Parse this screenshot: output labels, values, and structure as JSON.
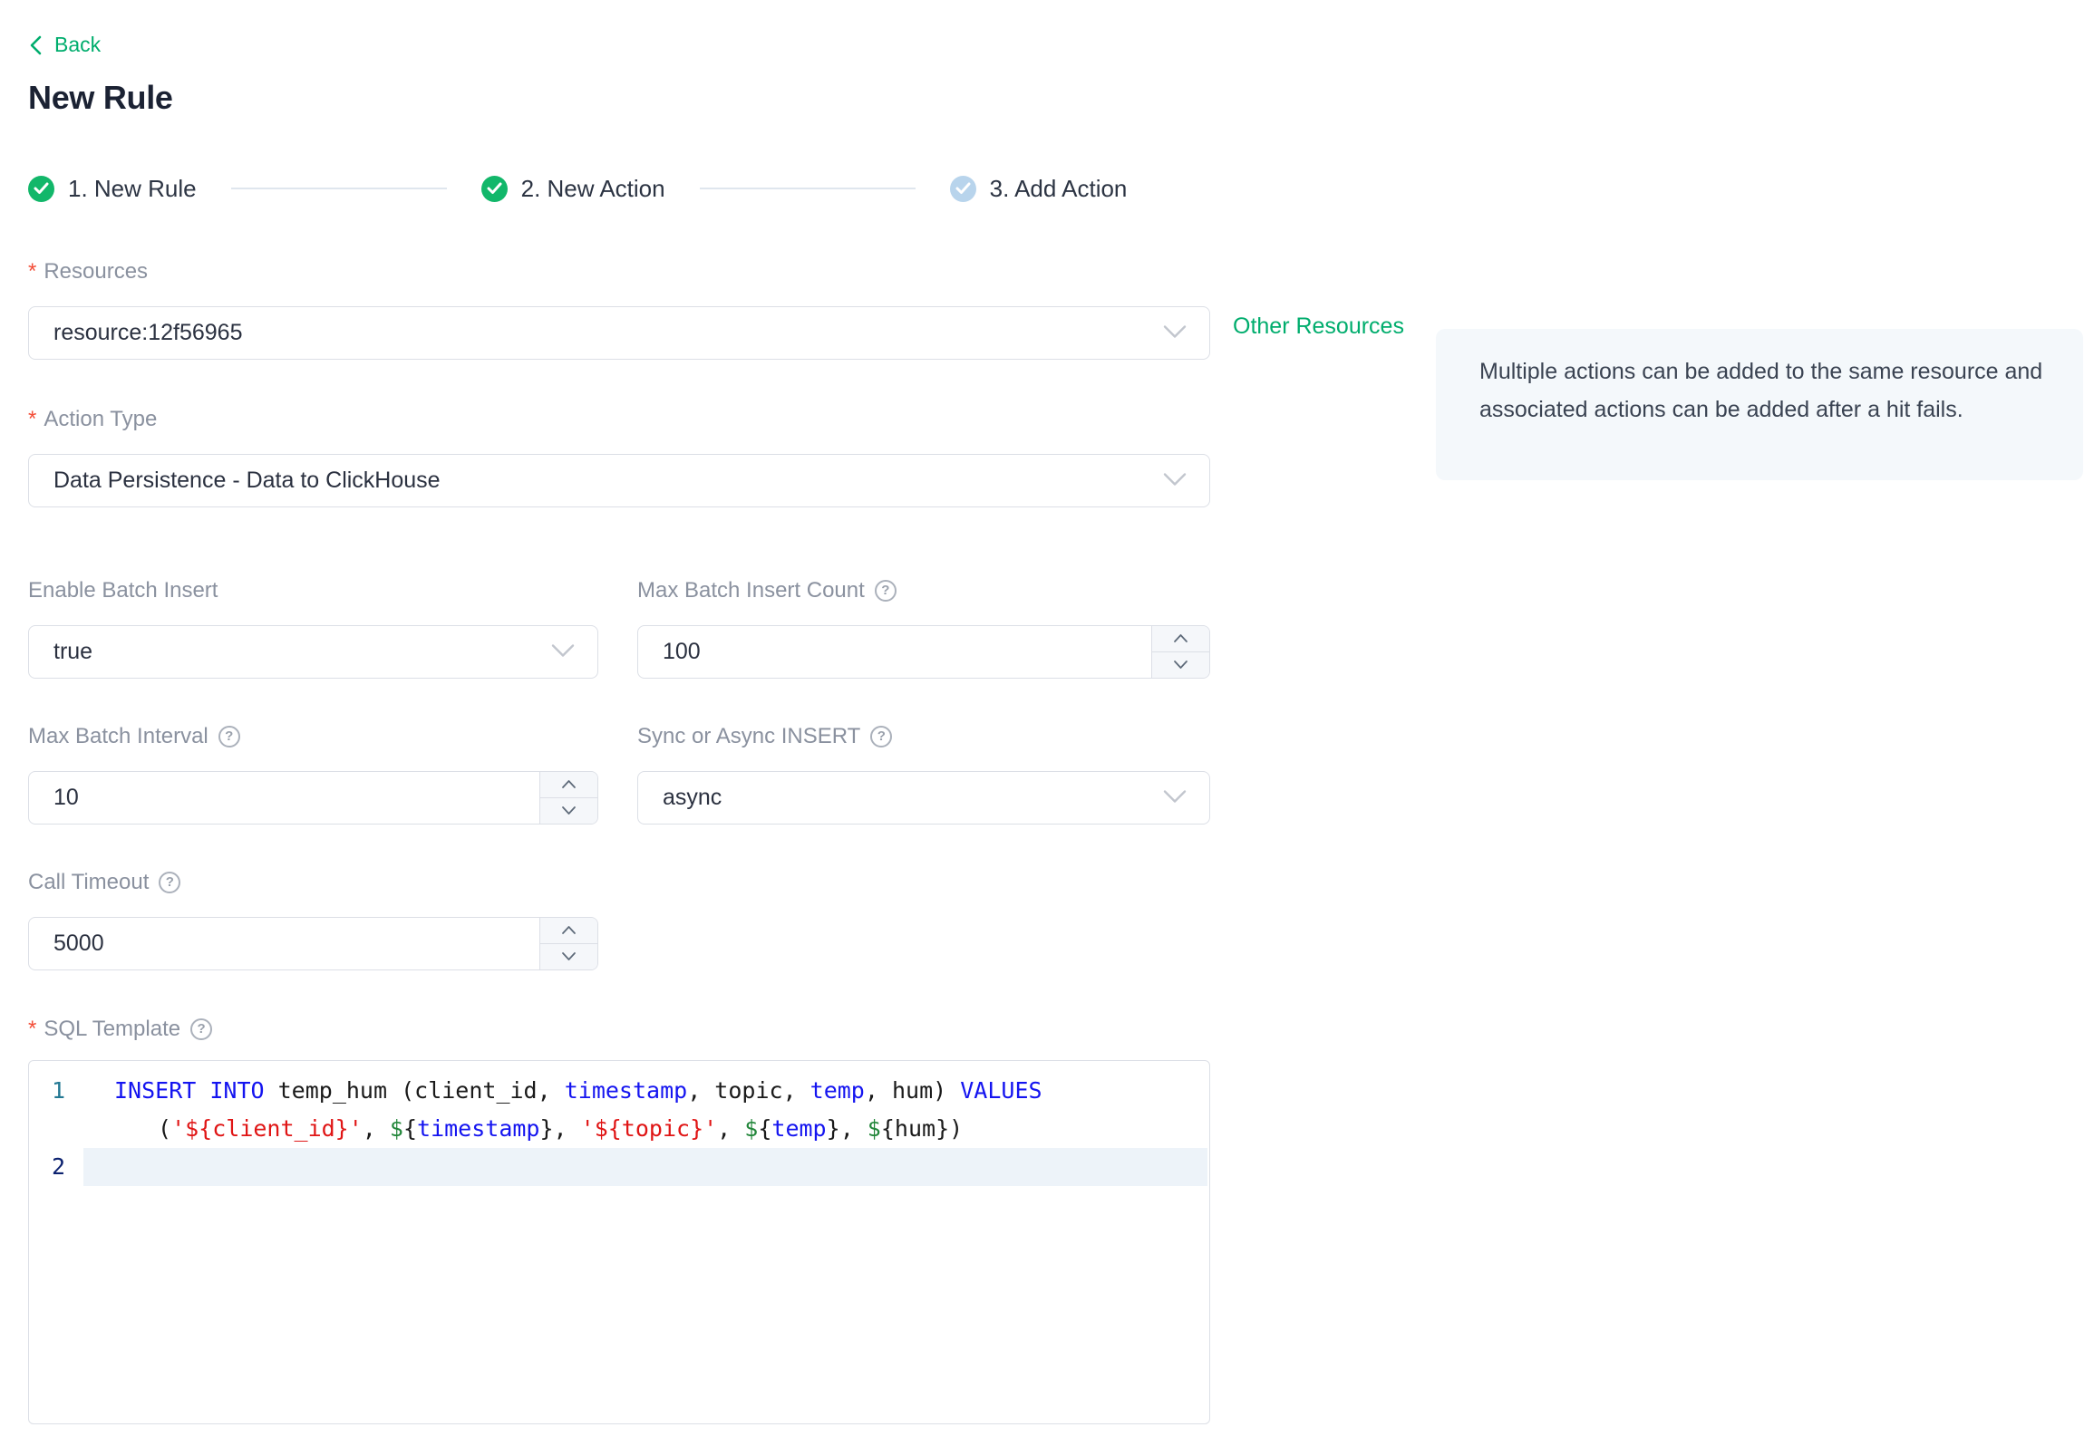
{
  "colors": {
    "accent_green": "#00ad6d",
    "step_done_green": "#12b76a",
    "step_pending_blue": "#b8d4ec",
    "required_red": "#f34d37",
    "info_box_bg": "#f4f8fb",
    "code_keyword_blue": "#1414f0",
    "code_string_red": "#e01515",
    "code_variable_green": "#22863a",
    "line_number_teal": "#237893",
    "active_line_number_navy": "#0b216f"
  },
  "header": {
    "back_label": "Back",
    "title": "New Rule"
  },
  "steps": [
    {
      "label": "1. New Rule",
      "state": "done"
    },
    {
      "label": "2. New Action",
      "state": "done"
    },
    {
      "label": "3. Add Action",
      "state": "pending"
    }
  ],
  "required_marker": "*",
  "help_glyph": "?",
  "form": {
    "resources": {
      "label": "Resources",
      "value": "resource:12f56965"
    },
    "other_resources": "Other Resources",
    "info_note": "Multiple actions can be added to the same resource and associated actions can be added after a hit fails.",
    "action_type": {
      "label": "Action Type",
      "value": "Data Persistence - Data to ClickHouse"
    },
    "enable_batch_insert": {
      "label": "Enable Batch Insert",
      "value": "true"
    },
    "max_batch_insert_count": {
      "label": "Max Batch Insert Count",
      "value": "100"
    },
    "max_batch_interval": {
      "label": "Max Batch Interval",
      "value": "10"
    },
    "sync_or_async_insert": {
      "label": "Sync or Async INSERT",
      "value": "async"
    },
    "call_timeout": {
      "label": "Call Timeout",
      "value": "5000"
    },
    "sql_template": {
      "label": "SQL Template"
    }
  },
  "sql_editor": {
    "sql_text": "INSERT INTO temp_hum (client_id, timestamp, topic, temp, hum) VALUES ('${client_id}', ${timestamp}, '${topic}', ${temp}, ${hum})",
    "lines": [
      {
        "number": "1",
        "active": false,
        "rows": [
          {
            "wrapped": false,
            "tokens": [
              {
                "text": "INSERT INTO",
                "style": "kw"
              },
              {
                "text": " temp_hum (client_id, ",
                "style": "plain"
              },
              {
                "text": "timestamp",
                "style": "kw"
              },
              {
                "text": ", topic, ",
                "style": "plain"
              },
              {
                "text": "temp",
                "style": "kw"
              },
              {
                "text": ", hum) ",
                "style": "plain"
              },
              {
                "text": "VALUES",
                "style": "kw"
              }
            ]
          },
          {
            "wrapped": true,
            "tokens": [
              {
                "text": "(",
                "style": "plain"
              },
              {
                "text": "'${client_id}'",
                "style": "str"
              },
              {
                "text": ", ",
                "style": "plain"
              },
              {
                "text": "$",
                "style": "var"
              },
              {
                "text": "{",
                "style": "plain"
              },
              {
                "text": "timestamp",
                "style": "kw"
              },
              {
                "text": "}",
                "style": "plain"
              },
              {
                "text": ", ",
                "style": "plain"
              },
              {
                "text": "'${topic}'",
                "style": "str"
              },
              {
                "text": ", ",
                "style": "plain"
              },
              {
                "text": "$",
                "style": "var"
              },
              {
                "text": "{",
                "style": "plain"
              },
              {
                "text": "temp",
                "style": "kw"
              },
              {
                "text": "}",
                "style": "plain"
              },
              {
                "text": ", ",
                "style": "plain"
              },
              {
                "text": "$",
                "style": "var"
              },
              {
                "text": "{hum})",
                "style": "plain"
              }
            ]
          }
        ]
      },
      {
        "number": "2",
        "active": true,
        "rows": [
          {
            "wrapped": false,
            "tokens": []
          }
        ]
      }
    ]
  }
}
